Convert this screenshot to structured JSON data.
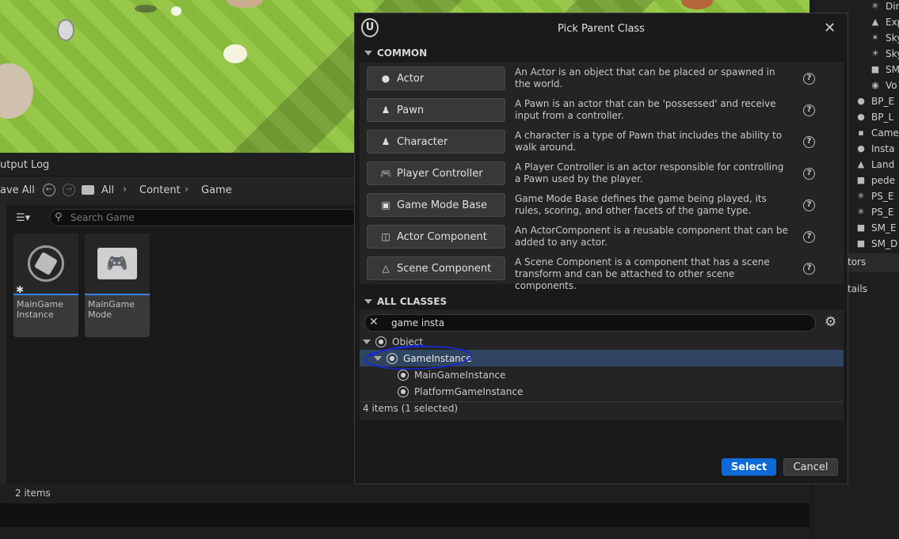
{
  "output_log": {
    "label": "utput Log"
  },
  "content_browser": {
    "save_all": "ave All",
    "breadcrumb": [
      "All",
      "Content",
      "Game"
    ],
    "search_placeholder": "Search Game",
    "assets": [
      {
        "name_line1": "MainGame",
        "name_line2": "Instance",
        "icon": "cube-asset-icon"
      },
      {
        "name_line1": "MainGame",
        "name_line2": "Mode",
        "icon": "gamepad-monitor-icon"
      }
    ],
    "item_count": "2 items"
  },
  "outliner": {
    "items": [
      "Dir",
      "Exp",
      "Sky",
      "Sky",
      "SM",
      "Vo",
      "BP_E",
      "BP_L",
      "Came",
      "Insta",
      "Land",
      "pede",
      "PS_E",
      "PS_E",
      "SM_E",
      "SM_D"
    ],
    "tab_actors": "tors",
    "tab_details": "tails"
  },
  "dialog": {
    "title": "Pick Parent Class",
    "common_header": "COMMON",
    "common_classes": [
      {
        "label": "Actor",
        "icon": "actor-icon",
        "desc": "An Actor is an object that can be placed or spawned in the world."
      },
      {
        "label": "Pawn",
        "icon": "pawn-icon",
        "desc": "A Pawn is an actor that can be 'possessed' and receive input from a controller."
      },
      {
        "label": "Character",
        "icon": "character-icon",
        "desc": "A character is a type of Pawn that includes the ability to walk around."
      },
      {
        "label": "Player Controller",
        "icon": "gamepad-icon",
        "desc": "A Player Controller is an actor responsible for controlling a Pawn used by the player."
      },
      {
        "label": "Game Mode Base",
        "icon": "game-mode-icon",
        "desc": "Game Mode Base defines the game being played, its rules, scoring, and other facets of the game type."
      },
      {
        "label": "Actor Component",
        "icon": "actor-component-icon",
        "desc": "An ActorComponent is a reusable component that can be added to any actor."
      },
      {
        "label": "Scene Component",
        "icon": "scene-component-icon",
        "desc": "A Scene Component is a component that has a scene transform and can be attached to other scene components."
      }
    ],
    "all_classes_header": "ALL CLASSES",
    "filter_value": "game insta",
    "tree": [
      {
        "label": "Object",
        "depth": 0
      },
      {
        "label": "GameInstance",
        "depth": 1,
        "selected": true
      },
      {
        "label": "MainGameInstance",
        "depth": 2
      },
      {
        "label": "PlatformGameInstance",
        "depth": 2
      }
    ],
    "status": "4 items (1 selected)",
    "select_label": "Select",
    "cancel_label": "Cancel"
  },
  "colors": {
    "accent": "#0e6ad6",
    "selection": "#2f4561",
    "annotation": "#1428d8"
  }
}
